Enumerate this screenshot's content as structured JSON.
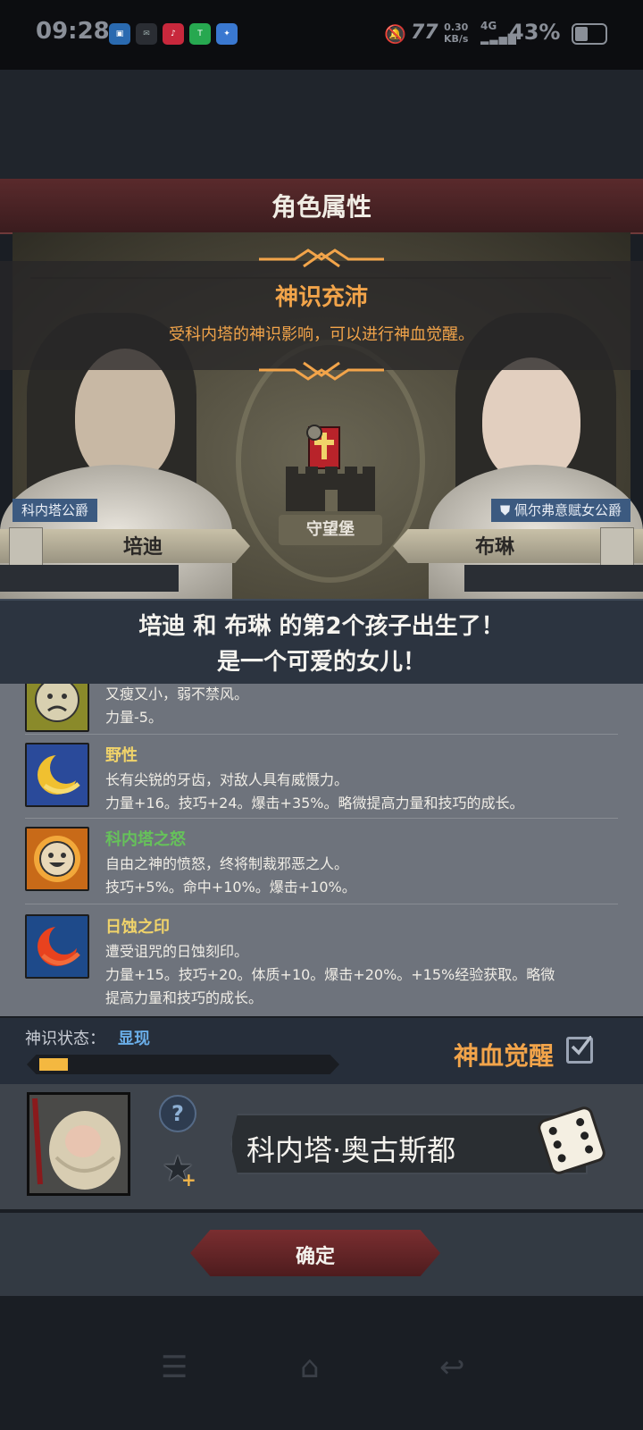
{
  "status_bar": {
    "time": "09:28",
    "apps": [
      "慢猫",
      "tiktok",
      "Tap",
      "bird"
    ],
    "speed_value": "0.30",
    "speed_unit": "KB/s",
    "network": "4G",
    "battery": "43%"
  },
  "header": {
    "title": "角色属性"
  },
  "notice": {
    "title": "神识充沛",
    "description": "受科内塔的神识影响，可以进行神血觉醒。"
  },
  "map": {
    "castle_label": "守望堡"
  },
  "father": {
    "title": "科内塔公爵",
    "name": "培迪"
  },
  "mother": {
    "title": "佩尔弗意赋女公爵",
    "name": "布琳"
  },
  "birth_message": {
    "line1": "培迪 和 布琳 的第2个孩子出生了！",
    "line2": "是一个可爱的女儿！"
  },
  "traits": [
    {
      "name": "",
      "lines": [
        "又瘦又小，弱不禁风。",
        "力量-5。"
      ],
      "icon": "sad-face-icon",
      "name_color": "#f0d36a"
    },
    {
      "name": "野性",
      "lines": [
        "长有尖锐的牙齿，对敌人具有威慑力。",
        "力量+16。技巧+24。爆击+35%。略微提高力量和技巧的成长。"
      ],
      "icon": "crescent-moon-icon",
      "name_color": "#f0d36a"
    },
    {
      "name": "科内塔之怒",
      "lines": [
        "自由之神的愤怒，终将制裁邪恶之人。",
        "技巧+5%。命中+10%。爆击+10%。"
      ],
      "icon": "smiling-sun-icon",
      "name_color": "#66c25a"
    },
    {
      "name": "日蚀之印",
      "lines": [
        "遭受诅咒的日蚀刻印。",
        "力量+15。技巧+20。体质+10。爆击+20%。+15%经验获取。略微",
        "提高力量和技巧的成长。"
      ],
      "icon": "eclipse-icon",
      "name_color": "#f0d36a"
    }
  ],
  "divine_state": {
    "label": "神识状态：",
    "value": "显现",
    "progress": 0.1,
    "awaken_label": "神血觉醒",
    "awaken_checked": true
  },
  "child": {
    "name": "科内塔·奥古斯都",
    "help_icon": "question-icon",
    "favorite_icon": "star-plus-icon",
    "random_icon": "dice-icon"
  },
  "confirm_label": "确定",
  "colors": {
    "accent_orange": "#f2a44a",
    "link_blue": "#6aaee8",
    "button_red": "#6a2628"
  }
}
